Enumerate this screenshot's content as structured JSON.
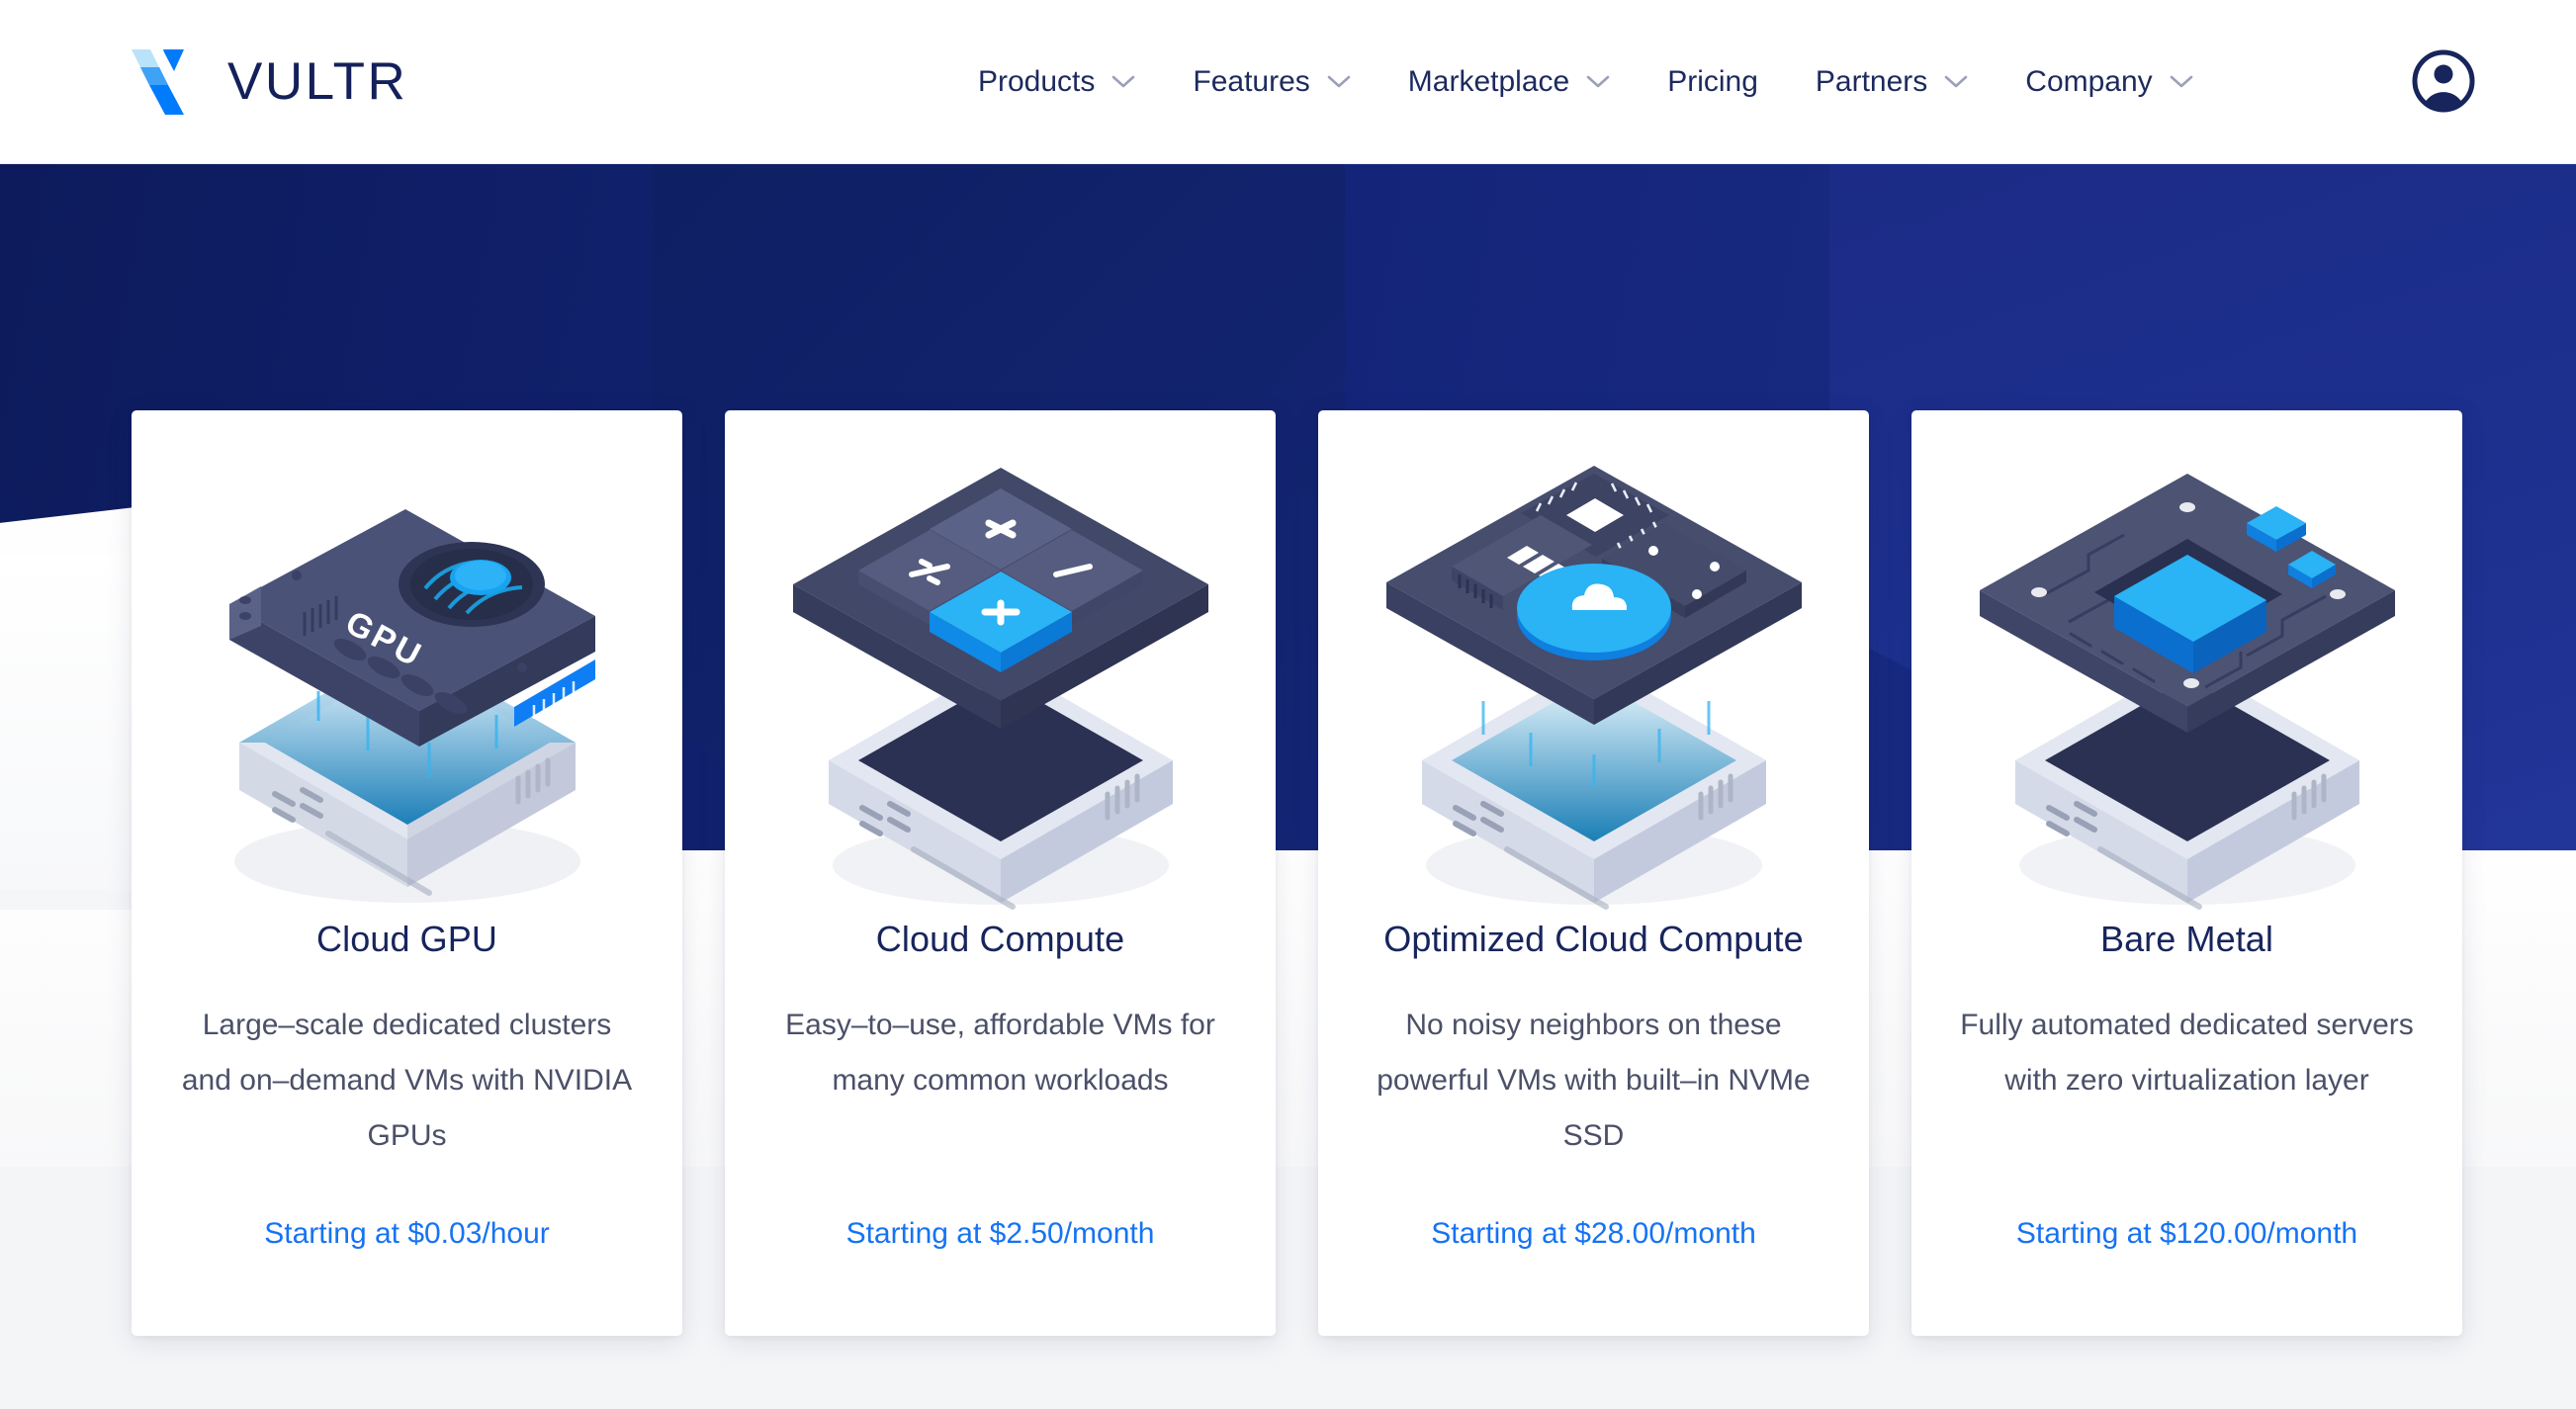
{
  "brand": {
    "name": "VULTR",
    "logo_icon": "vultr-v-logo-icon",
    "navy": "#14205a",
    "blue": "#007bfc",
    "light_blue": "#3ea2f7"
  },
  "header": {
    "nav_items": [
      {
        "label": "Products",
        "has_dropdown": true,
        "icon": "chevron-down-icon"
      },
      {
        "label": "Features",
        "has_dropdown": true,
        "icon": "chevron-down-icon"
      },
      {
        "label": "Marketplace",
        "has_dropdown": true,
        "icon": "chevron-down-icon"
      },
      {
        "label": "Pricing",
        "has_dropdown": false,
        "icon": ""
      },
      {
        "label": "Partners",
        "has_dropdown": true,
        "icon": "chevron-down-icon"
      },
      {
        "label": "Company",
        "has_dropdown": true,
        "icon": "chevron-down-icon"
      }
    ],
    "account_icon": "account-circle-icon"
  },
  "hero_form": {
    "field_1_value": "",
    "field_2_value": "",
    "cta_label": ""
  },
  "products": [
    {
      "title": "Cloud GPU",
      "description": "Large–scale dedicated clusters and on–demand VMs with NVIDIA GPUs",
      "price": "Starting at $0.03/hour",
      "illustration": "gpu-card-isometric-icon"
    },
    {
      "title": "Cloud Compute",
      "description": "Easy–to–use, affordable VMs for many common workloads",
      "price": "Starting at $2.50/month",
      "illustration": "compute-tiles-isometric-icon"
    },
    {
      "title": "Optimized Cloud Compute",
      "description": "No noisy neighbors on these powerful VMs with built–in NVMe SSD",
      "price": "Starting at $28.00/month",
      "illustration": "motherboard-cloud-isometric-icon"
    },
    {
      "title": "Bare Metal",
      "description": "Fully automated dedicated servers with zero virtualization layer",
      "price": "Starting at $120.00/month",
      "illustration": "cpu-chip-isometric-icon"
    }
  ]
}
